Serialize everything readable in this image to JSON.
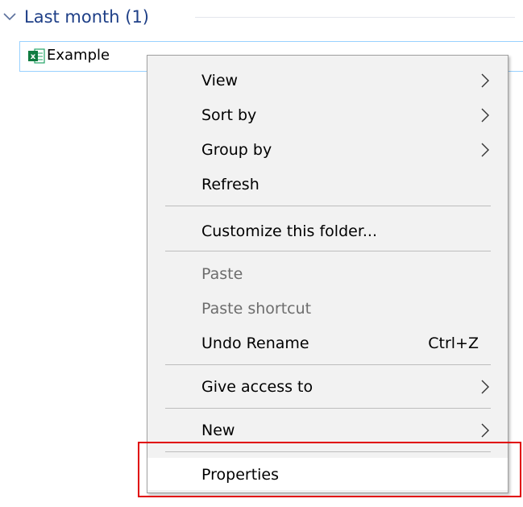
{
  "group": {
    "title": "Last month (1)",
    "icon": "chevron-down-icon"
  },
  "file": {
    "name": "Example",
    "icon": "excel-file-icon"
  },
  "menu": {
    "items": [
      {
        "label": "View",
        "submenu": true
      },
      {
        "label": "Sort by",
        "submenu": true
      },
      {
        "label": "Group by",
        "submenu": true
      },
      {
        "label": "Refresh"
      },
      {
        "label": "Customize this folder..."
      },
      {
        "label": "Paste",
        "disabled": true
      },
      {
        "label": "Paste shortcut",
        "disabled": true
      },
      {
        "label": "Undo Rename",
        "shortcut": "Ctrl+Z"
      },
      {
        "label": "Give access to",
        "submenu": true
      },
      {
        "label": "New",
        "submenu": true
      },
      {
        "label": "Properties",
        "highlighted": true
      }
    ]
  },
  "colors": {
    "group_title": "#1e3f87",
    "highlight_box": "#e00000",
    "selection_border": "#99d1ff",
    "menu_background": "#f2f2f2"
  }
}
